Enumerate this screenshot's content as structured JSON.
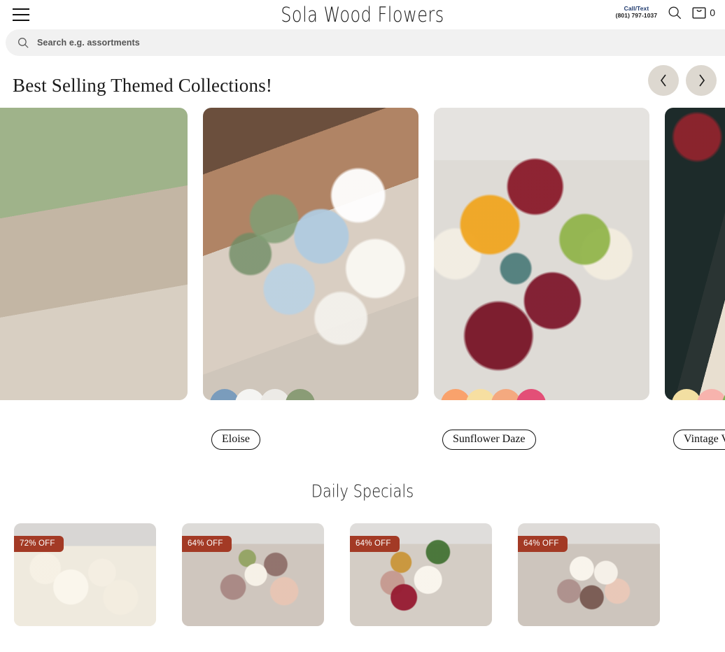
{
  "header": {
    "menu_icon": "hamburger-menu-icon",
    "brand": "Sola Wood Flowers",
    "contact_label": "Call/Text",
    "contact_phone": "(801) 797-1037",
    "search_icon": "search-icon",
    "cart_icon": "shopping-bag-icon",
    "cart_count": "0",
    "contact_color": "#1f3a6e"
  },
  "search": {
    "icon": "search-icon",
    "placeholder": "Search e.g. assortments",
    "value": ""
  },
  "collections": {
    "title": "Best Selling Themed Collections!",
    "prev_icon": "chevron-left-icon",
    "next_icon": "chevron-right-icon",
    "nav_bg": "#ddd8d0",
    "cards": [
      {
        "name": "Eloise",
        "photo": "bride-holding-blue-and-white-bouquet",
        "swatches": [
          "#7a9cbc",
          "#f4f4f2",
          "#eceae6",
          "#8a9c76"
        ]
      },
      {
        "name": "Sunflower Daze",
        "photo": "burgundy-and-marigold-bouquet",
        "swatches": [
          "#f9a26c",
          "#f7dfa1",
          "#f4a97f",
          "#e34f77"
        ]
      },
      {
        "name": "Vintage Vineyard",
        "photo": "bride-and-groom-with-vintage-bouquet",
        "swatches": [
          "#f2dfa2",
          "#f7b3ad",
          "#85b457",
          "#f0dba4"
        ]
      }
    ]
  },
  "daily_specials": {
    "title": "Daily Specials",
    "items": [
      {
        "discount": "72% OFF",
        "photo": "ivory-sola-flower-assortment"
      },
      {
        "discount": "64% OFF",
        "photo": "mauve-and-ivory-bouquet"
      },
      {
        "discount": "64% OFF",
        "photo": "burgundy-gold-and-ivory-bouquet"
      },
      {
        "discount": "64% OFF",
        "photo": "blush-and-mauve-bouquet"
      }
    ],
    "badge_color": "#a33a25"
  }
}
